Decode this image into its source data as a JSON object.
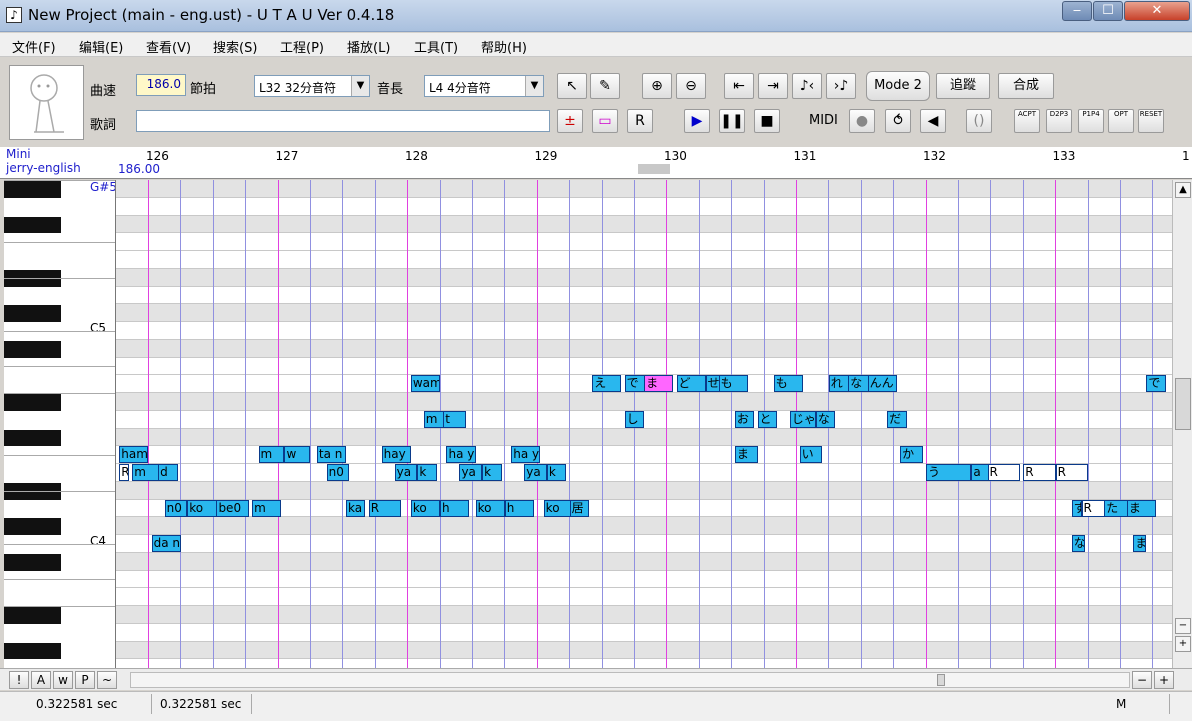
{
  "window": {
    "title": "New Project (main - eng.ust) - U T A U Ver 0.4.18",
    "minimize": "‒",
    "maximize": "☐",
    "close": "✕"
  },
  "menu": [
    "文件(F)",
    "编辑(E)",
    "查看(V)",
    "搜索(S)",
    "工程(P)",
    "播放(L)",
    "工具(T)",
    "帮助(H)"
  ],
  "toolbar": {
    "tempo_label": "曲速",
    "tempo_value": "186.0",
    "beat_label": "節拍",
    "quantize_value": "L32 32分音符",
    "length_label": "音長",
    "length_value": "L4  4分音符",
    "lyric_label": "歌詞",
    "lyric_value": "",
    "mode_button": "Mode 2",
    "append_button": "追蹤",
    "render_button": "合成",
    "midi_label": "MIDI",
    "icons": [
      "pointer-icon",
      "pencil-icon",
      "zoom-in-icon",
      "zoom-out-icon",
      "jump-start-icon",
      "jump-end-icon",
      "narrow-notes-icon",
      "widen-notes-icon"
    ],
    "env_buttons": [
      "ACPT",
      "D2P3",
      "P1P4",
      "OPT",
      "RESET"
    ]
  },
  "ruler": {
    "singer_line1": "Mini",
    "singer_line2": "jerry-english",
    "tempo_mark": "186.00",
    "measures": [
      "126",
      "127",
      "128",
      "129",
      "130",
      "131",
      "132",
      "133",
      "1"
    ]
  },
  "piano_labels": [
    "G#5",
    "C5",
    "C4"
  ],
  "notes": [
    {
      "row": 11,
      "start": 9.1,
      "len": 0.9,
      "text": "wam"
    },
    {
      "row": 11,
      "start": 14.7,
      "len": 0.9,
      "text": "え"
    },
    {
      "row": 11,
      "start": 15.7,
      "len": 0.9,
      "text": "で"
    },
    {
      "row": 11,
      "start": 16.3,
      "len": 0.9,
      "text": "ま",
      "sel": true
    },
    {
      "row": 11,
      "start": 17.3,
      "len": 0.9,
      "text": "ど"
    },
    {
      "row": 11,
      "start": 18.2,
      "len": 0.9,
      "text": "せ"
    },
    {
      "row": 11,
      "start": 18.6,
      "len": 0.9,
      "text": "も"
    },
    {
      "row": 11,
      "start": 20.3,
      "len": 0.9,
      "text": "も"
    },
    {
      "row": 11,
      "start": 22.0,
      "len": 0.7,
      "text": "れ"
    },
    {
      "row": 11,
      "start": 22.6,
      "len": 0.7,
      "text": "な"
    },
    {
      "row": 11,
      "start": 23.2,
      "len": 0.9,
      "text": "んん"
    },
    {
      "row": 11,
      "start": 31.8,
      "len": 0.6,
      "text": "で"
    },
    {
      "row": 13,
      "start": 9.5,
      "len": 0.7,
      "text": "m"
    },
    {
      "row": 13,
      "start": 10.1,
      "len": 0.7,
      "text": "t"
    },
    {
      "row": 13,
      "start": 15.7,
      "len": 0.6,
      "text": "し"
    },
    {
      "row": 13,
      "start": 19.1,
      "len": 0.6,
      "text": "お"
    },
    {
      "row": 13,
      "start": 19.8,
      "len": 0.6,
      "text": "と"
    },
    {
      "row": 13,
      "start": 20.8,
      "len": 0.8,
      "text": "じゃ"
    },
    {
      "row": 13,
      "start": 21.6,
      "len": 0.6,
      "text": "な"
    },
    {
      "row": 13,
      "start": 23.8,
      "len": 0.6,
      "text": "だ"
    },
    {
      "row": 15,
      "start": 0.1,
      "len": 0.9,
      "text": "ham"
    },
    {
      "row": 15,
      "start": 4.4,
      "len": 0.8,
      "text": "m"
    },
    {
      "row": 15,
      "start": 5.2,
      "len": 0.8,
      "text": "w"
    },
    {
      "row": 15,
      "start": 6.2,
      "len": 0.9,
      "text": "ta n"
    },
    {
      "row": 15,
      "start": 8.2,
      "len": 0.9,
      "text": "hay"
    },
    {
      "row": 15,
      "start": 10.2,
      "len": 0.9,
      "text": "ha y"
    },
    {
      "row": 15,
      "start": 12.2,
      "len": 0.9,
      "text": "ha y"
    },
    {
      "row": 15,
      "start": 19.1,
      "len": 0.7,
      "text": "ま"
    },
    {
      "row": 15,
      "start": 21.1,
      "len": 0.7,
      "text": "い"
    },
    {
      "row": 15,
      "start": 24.2,
      "len": 0.7,
      "text": "か"
    },
    {
      "row": 16,
      "start": 0.1,
      "len": 0.3,
      "text": "R",
      "rest": true
    },
    {
      "row": 16,
      "start": 0.5,
      "len": 0.9,
      "text": "m"
    },
    {
      "row": 16,
      "start": 1.3,
      "len": 0.6,
      "text": "d"
    },
    {
      "row": 16,
      "start": 6.5,
      "len": 0.7,
      "text": "n0"
    },
    {
      "row": 16,
      "start": 8.6,
      "len": 0.7,
      "text": "ya"
    },
    {
      "row": 16,
      "start": 9.3,
      "len": 0.6,
      "text": "k"
    },
    {
      "row": 16,
      "start": 10.6,
      "len": 0.7,
      "text": "ya"
    },
    {
      "row": 16,
      "start": 11.3,
      "len": 0.6,
      "text": "k"
    },
    {
      "row": 16,
      "start": 12.6,
      "len": 0.7,
      "text": "ya"
    },
    {
      "row": 16,
      "start": 13.3,
      "len": 0.6,
      "text": "k"
    },
    {
      "row": 16,
      "start": 25.0,
      "len": 1.4,
      "text": "う"
    },
    {
      "row": 16,
      "start": 26.4,
      "len": 0.6,
      "text": "a"
    },
    {
      "row": 16,
      "start": 26.9,
      "len": 1.0,
      "text": "R",
      "rest": true
    },
    {
      "row": 16,
      "start": 28.0,
      "len": 1.0,
      "text": "R",
      "rest": true
    },
    {
      "row": 16,
      "start": 29.0,
      "len": 1.0,
      "text": "R",
      "rest": true
    },
    {
      "row": 18,
      "start": 1.5,
      "len": 0.7,
      "text": "n0"
    },
    {
      "row": 18,
      "start": 2.2,
      "len": 1.0,
      "text": "ko"
    },
    {
      "row": 18,
      "start": 3.1,
      "len": 1.0,
      "text": "be0"
    },
    {
      "row": 18,
      "start": 4.2,
      "len": 0.9,
      "text": "m"
    },
    {
      "row": 18,
      "start": 7.1,
      "len": 0.6,
      "text": "ka"
    },
    {
      "row": 18,
      "start": 7.8,
      "len": 1.0,
      "text": "R"
    },
    {
      "row": 18,
      "start": 9.1,
      "len": 0.9,
      "text": "ko"
    },
    {
      "row": 18,
      "start": 10.0,
      "len": 0.9,
      "text": "h"
    },
    {
      "row": 18,
      "start": 11.1,
      "len": 0.9,
      "text": "ko"
    },
    {
      "row": 18,
      "start": 12.0,
      "len": 0.9,
      "text": "h"
    },
    {
      "row": 18,
      "start": 13.2,
      "len": 0.9,
      "text": "ko"
    },
    {
      "row": 18,
      "start": 14.0,
      "len": 0.6,
      "text": "居"
    },
    {
      "row": 18,
      "start": 29.5,
      "len": 0.3,
      "text": "す"
    },
    {
      "row": 18,
      "start": 29.8,
      "len": 0.9,
      "text": "R",
      "rest": true
    },
    {
      "row": 18,
      "start": 30.5,
      "len": 0.9,
      "text": "た"
    },
    {
      "row": 18,
      "start": 31.2,
      "len": 0.9,
      "text": "ま"
    },
    {
      "row": 20,
      "start": 1.1,
      "len": 0.9,
      "text": "da n"
    },
    {
      "row": 20,
      "start": 29.5,
      "len": 0.4,
      "text": "な"
    },
    {
      "row": 20,
      "start": 31.4,
      "len": 0.4,
      "text": "ま"
    }
  ],
  "bottom": {
    "buttons": [
      "!",
      "A",
      "w",
      "P",
      "~"
    ],
    "minus": "−",
    "plus": "+"
  },
  "status": {
    "time1": "0.322581 sec",
    "time2": "0.322581 sec",
    "mode": "M"
  }
}
